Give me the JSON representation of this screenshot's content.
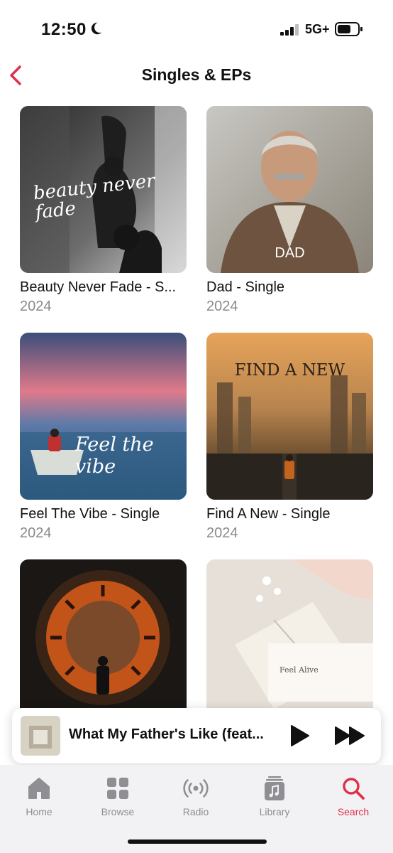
{
  "status": {
    "time": "12:50",
    "network": "5G+"
  },
  "header": {
    "title": "Singles & EPs"
  },
  "albums": [
    {
      "title": "Beauty Never Fade - S...",
      "year": "2024",
      "art_text": "beauty never fade"
    },
    {
      "title": "Dad - Single",
      "year": "2024",
      "art_text": "DAD"
    },
    {
      "title": "Feel The Vibe - Single",
      "year": "2024",
      "art_text": "Feel the vibe"
    },
    {
      "title": "Find A New - Single",
      "year": "2024",
      "art_text": "FIND A NEW"
    },
    {
      "art_text": ""
    },
    {
      "art_text": "Feel Alive"
    }
  ],
  "player": {
    "title": "What My Father's Like (feat..."
  },
  "tabs": [
    {
      "label": "Home",
      "icon": "house-icon"
    },
    {
      "label": "Browse",
      "icon": "grid-icon"
    },
    {
      "label": "Radio",
      "icon": "radio-icon"
    },
    {
      "label": "Library",
      "icon": "library-icon"
    },
    {
      "label": "Search",
      "icon": "search-icon",
      "active": true
    }
  ],
  "colors": {
    "accent": "#e0304a",
    "inactive": "#8e8e93"
  }
}
